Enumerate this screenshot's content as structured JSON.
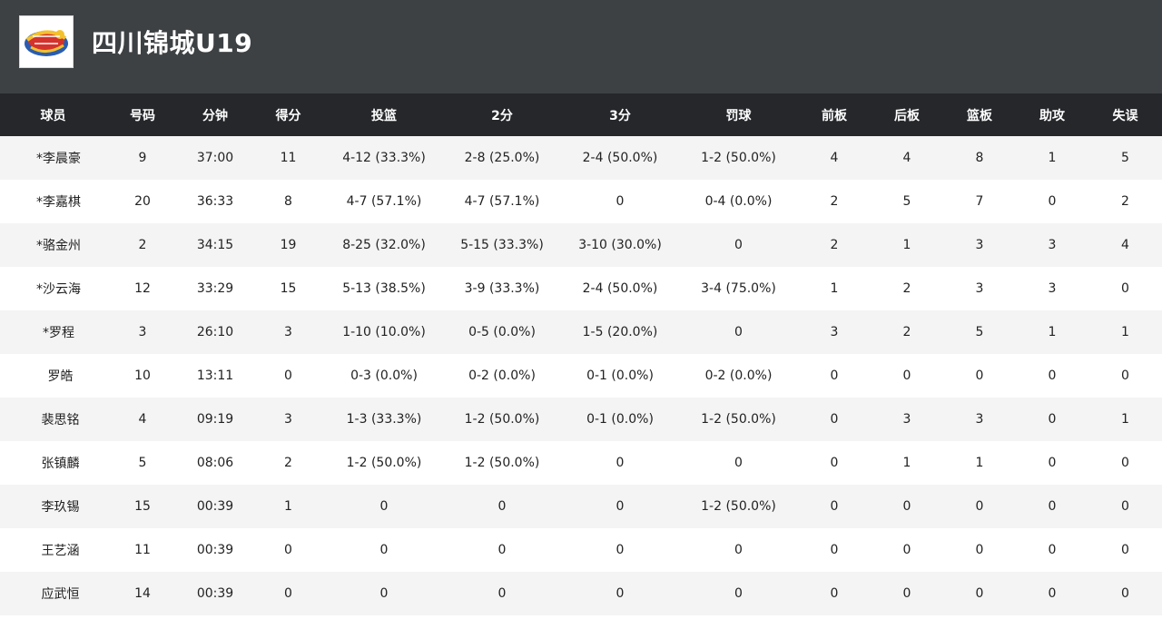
{
  "header": {
    "team_name": "四川锦城U19",
    "logo_icon": "team-logo-icon"
  },
  "colors": {
    "header_bg": "#3e4144",
    "table_header_bg": "#25272b",
    "row_alt_bg": "#f4f4f4",
    "logo_red": "#d4322c",
    "logo_blue": "#2a5db0",
    "logo_yellow": "#f2c12e"
  },
  "table": {
    "columns": [
      "球员",
      "号码",
      "分钟",
      "得分",
      "投篮",
      "2分",
      "3分",
      "罚球",
      "前板",
      "后板",
      "篮板",
      "助攻",
      "失误"
    ],
    "rows": [
      [
        "*李晨豪",
        "9",
        "37:00",
        "11",
        "4-12 (33.3%)",
        "2-8 (25.0%)",
        "2-4 (50.0%)",
        "1-2 (50.0%)",
        "4",
        "4",
        "8",
        "1",
        "5"
      ],
      [
        "*李嘉棋",
        "20",
        "36:33",
        "8",
        "4-7 (57.1%)",
        "4-7 (57.1%)",
        "0",
        "0-4 (0.0%)",
        "2",
        "5",
        "7",
        "0",
        "2"
      ],
      [
        "*骆金州",
        "2",
        "34:15",
        "19",
        "8-25 (32.0%)",
        "5-15 (33.3%)",
        "3-10 (30.0%)",
        "0",
        "2",
        "1",
        "3",
        "3",
        "4"
      ],
      [
        "*沙云海",
        "12",
        "33:29",
        "15",
        "5-13 (38.5%)",
        "3-9 (33.3%)",
        "2-4 (50.0%)",
        "3-4 (75.0%)",
        "1",
        "2",
        "3",
        "3",
        "0"
      ],
      [
        "*罗程",
        "3",
        "26:10",
        "3",
        "1-10 (10.0%)",
        "0-5 (0.0%)",
        "1-5 (20.0%)",
        "0",
        "3",
        "2",
        "5",
        "1",
        "1"
      ],
      [
        "罗皓",
        "10",
        "13:11",
        "0",
        "0-3 (0.0%)",
        "0-2 (0.0%)",
        "0-1 (0.0%)",
        "0-2 (0.0%)",
        "0",
        "0",
        "0",
        "0",
        "0"
      ],
      [
        "裴思铭",
        "4",
        "09:19",
        "3",
        "1-3 (33.3%)",
        "1-2 (50.0%)",
        "0-1 (0.0%)",
        "1-2 (50.0%)",
        "0",
        "3",
        "3",
        "0",
        "1"
      ],
      [
        "张镇麟",
        "5",
        "08:06",
        "2",
        "1-2 (50.0%)",
        "1-2 (50.0%)",
        "0",
        "0",
        "0",
        "1",
        "1",
        "0",
        "0"
      ],
      [
        "李玖锡",
        "15",
        "00:39",
        "1",
        "0",
        "0",
        "0",
        "1-2 (50.0%)",
        "0",
        "0",
        "0",
        "0",
        "0"
      ],
      [
        "王艺涵",
        "11",
        "00:39",
        "0",
        "0",
        "0",
        "0",
        "0",
        "0",
        "0",
        "0",
        "0",
        "0"
      ],
      [
        "应武恒",
        "14",
        "00:39",
        "0",
        "0",
        "0",
        "0",
        "0",
        "0",
        "0",
        "0",
        "0",
        "0"
      ]
    ]
  }
}
